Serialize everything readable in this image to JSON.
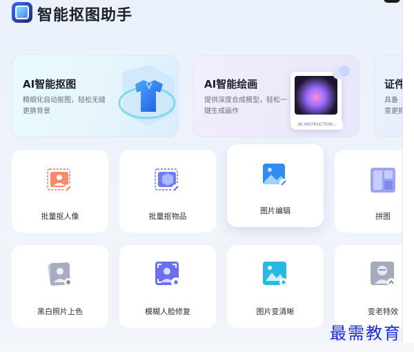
{
  "app": {
    "title": "智能抠图助手"
  },
  "feature_cards": [
    {
      "title": "AI智能抠图",
      "desc": "精细化自动抠图，轻松无缝更换背景"
    },
    {
      "title": "AI智能绘画",
      "desc": "提供深度合成模型，轻松一键生成画作",
      "art_caption": "/AI INSTRUCTION..."
    },
    {
      "title": "证件",
      "desc": "具备\n意更换"
    }
  ],
  "tools": [
    {
      "label": "批量抠人像"
    },
    {
      "label": "批量抠物品"
    },
    {
      "label": "图片编辑"
    },
    {
      "label": "拼图"
    },
    {
      "label": "黑白照片上色"
    },
    {
      "label": "模糊人脸修复"
    },
    {
      "label": "图片变清晰"
    },
    {
      "label": "变老特效"
    }
  ],
  "watermark": "最需教育",
  "colors": {
    "accent": "#3b6cff",
    "watermark": "#1c2bd8"
  }
}
